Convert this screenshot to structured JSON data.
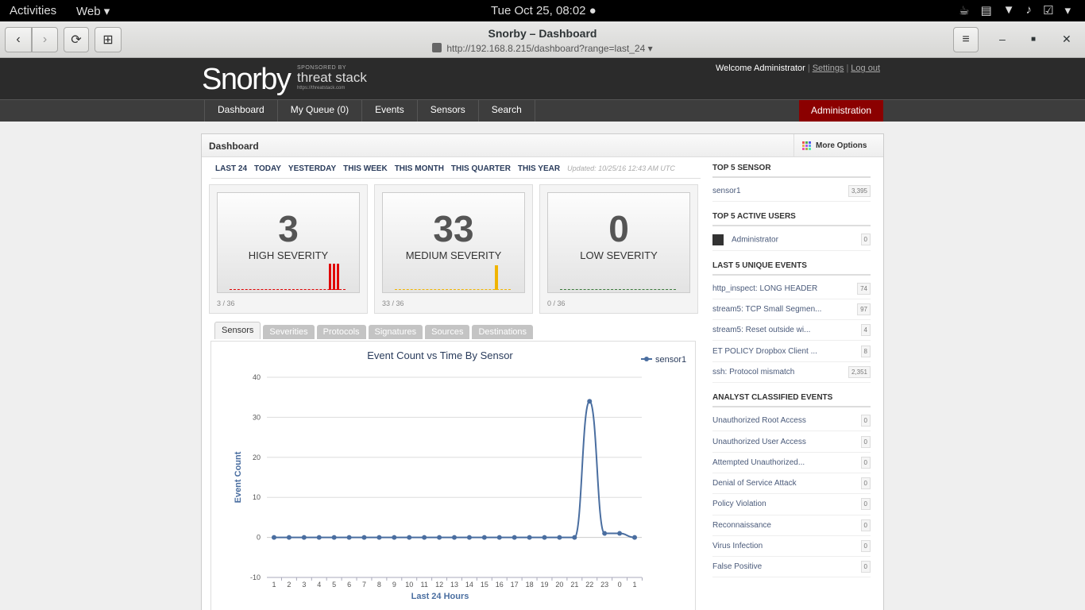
{
  "system_bar": {
    "activities": "Activities",
    "app_menu": "Web ▾",
    "clock": "Tue Oct 25, 08:02 ●"
  },
  "browser": {
    "title": "Snorby – Dashboard",
    "url": "http://192.168.8.215/dashboard?range=last_24 ▾"
  },
  "site": {
    "logo": "Snorby",
    "sponsored_by": "SPONSORED BY",
    "sponsor_name": "threat stack",
    "sponsor_url": "https://threatstack.com",
    "welcome": "Welcome Administrator",
    "settings": "Settings",
    "logout": "Log out",
    "nav": [
      "Dashboard",
      "My Queue (0)",
      "Events",
      "Sensors",
      "Search"
    ],
    "admin": "Administration"
  },
  "dashboard": {
    "title": "Dashboard",
    "more_options": "More Options",
    "ranges": [
      "LAST 24",
      "TODAY",
      "YESTERDAY",
      "THIS WEEK",
      "THIS MONTH",
      "THIS QUARTER",
      "THIS YEAR"
    ],
    "updated": "Updated: 10/25/16 12:43 AM UTC",
    "severities": [
      {
        "count": "3",
        "label": "HIGH SEVERITY",
        "ratio": "3 / 36",
        "color": "#e00000"
      },
      {
        "count": "33",
        "label": "MEDIUM SEVERITY",
        "ratio": "33 / 36",
        "color": "#f0b400"
      },
      {
        "count": "0",
        "label": "LOW SEVERITY",
        "ratio": "0 / 36",
        "color": "#3a7a3a"
      }
    ],
    "tabs": [
      "Sensors",
      "Severities",
      "Protocols",
      "Signatures",
      "Sources",
      "Destinations"
    ]
  },
  "sidebar": {
    "top_sensor": {
      "heading": "TOP 5 SENSOR",
      "items": [
        {
          "name": "sensor1",
          "count": "3,395"
        }
      ]
    },
    "top_users": {
      "heading": "TOP 5 ACTIVE USERS",
      "items": [
        {
          "name": "Administrator",
          "count": "0"
        }
      ]
    },
    "unique_events": {
      "heading": "LAST 5 UNIQUE EVENTS",
      "items": [
        {
          "name": "http_inspect: LONG HEADER",
          "count": "74"
        },
        {
          "name": "stream5: TCP Small Segmen...",
          "count": "97"
        },
        {
          "name": "stream5: Reset outside wi...",
          "count": "4"
        },
        {
          "name": "ET POLICY Dropbox Client ...",
          "count": "8"
        },
        {
          "name": "ssh: Protocol mismatch",
          "count": "2,351"
        }
      ]
    },
    "classified": {
      "heading": "ANALYST CLASSIFIED EVENTS",
      "items": [
        {
          "name": "Unauthorized Root Access",
          "count": "0"
        },
        {
          "name": "Unauthorized User Access",
          "count": "0"
        },
        {
          "name": "Attempted Unauthorized...",
          "count": "0"
        },
        {
          "name": "Denial of Service Attack",
          "count": "0"
        },
        {
          "name": "Policy Violation",
          "count": "0"
        },
        {
          "name": "Reconnaissance",
          "count": "0"
        },
        {
          "name": "Virus Infection",
          "count": "0"
        },
        {
          "name": "False Positive",
          "count": "0"
        }
      ]
    }
  },
  "chart_data": {
    "type": "line",
    "title": "Event Count vs Time By Sensor",
    "xlabel": "Last 24 Hours",
    "ylabel": "Event Count",
    "categories": [
      "1",
      "2",
      "3",
      "4",
      "5",
      "6",
      "7",
      "8",
      "9",
      "10",
      "11",
      "12",
      "13",
      "14",
      "15",
      "16",
      "17",
      "18",
      "19",
      "20",
      "21",
      "22",
      "23",
      "0",
      "1"
    ],
    "ylim": [
      -10,
      40
    ],
    "yticks": [
      -10,
      0,
      10,
      20,
      30,
      40
    ],
    "grid": true,
    "legend": "top-right",
    "series": [
      {
        "name": "sensor1",
        "color": "#4a6ea0",
        "values": [
          0,
          0,
          0,
          0,
          0,
          0,
          0,
          0,
          0,
          0,
          0,
          0,
          0,
          0,
          0,
          0,
          0,
          0,
          0,
          0,
          0,
          34,
          1,
          1,
          0
        ]
      }
    ]
  }
}
